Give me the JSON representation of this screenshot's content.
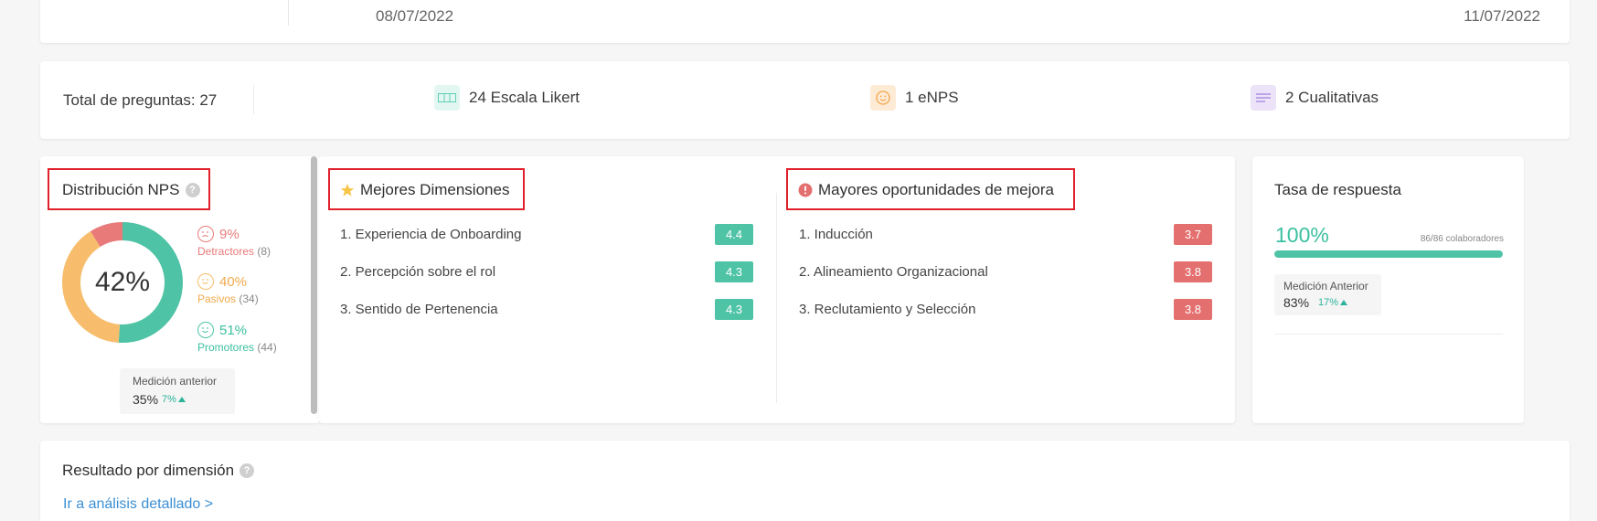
{
  "dates": {
    "start": "08/07/2022",
    "end": "11/07/2022"
  },
  "questions": {
    "total_label": "Total de preguntas: 27",
    "likert": {
      "label": "24 Escala Likert",
      "icon": "likert-scale-icon"
    },
    "enps": {
      "label": "1 eNPS",
      "icon": "smiley-icon"
    },
    "qualitative": {
      "label": "2 Cualitativas",
      "icon": "text-lines-icon"
    }
  },
  "nps": {
    "title": "Distribución NPS",
    "help": "?",
    "score": "42%",
    "segments": [
      {
        "key": "detractores",
        "pct": 9,
        "pct_label": "9%",
        "name": "Detractores",
        "count": "(8)",
        "color": "#e97a7a"
      },
      {
        "key": "pasivos",
        "pct": 40,
        "pct_label": "40%",
        "name": "Pasivos",
        "count": "(34)",
        "color": "#f7bd6c"
      },
      {
        "key": "promotores",
        "pct": 51,
        "pct_label": "51%",
        "name": "Promotores",
        "count": "(44)",
        "color": "#4ec3a6"
      }
    ],
    "previous": {
      "label": "Medición anterior",
      "value": "35%",
      "delta": "7%"
    }
  },
  "best": {
    "title": "Mejores Dimensiones",
    "items": [
      {
        "label": "1.  Experiencia de Onboarding",
        "score": "4.4"
      },
      {
        "label": "2.  Percepción sobre el rol",
        "score": "4.3"
      },
      {
        "label": "3.  Sentido de Pertenencia",
        "score": "4.3"
      }
    ]
  },
  "worst": {
    "title": "Mayores oportunidades de mejora",
    "items": [
      {
        "label": "1.  Inducción",
        "score": "3.7"
      },
      {
        "label": "2.  Alineamiento Organizacional",
        "score": "3.8"
      },
      {
        "label": "3.  Reclutamiento y Selección",
        "score": "3.8"
      }
    ]
  },
  "rate": {
    "title": "Tasa de respuesta",
    "value": "100%",
    "fraction": 1.0,
    "count": "86/86 colaboradores",
    "previous": {
      "label": "Medición Anterior",
      "value": "83%",
      "delta": "17%"
    }
  },
  "result": {
    "title": "Resultado por dimensión",
    "help": "?",
    "link": "Ir a análisis detallado >"
  },
  "colors": {
    "good": "#4ec3a6",
    "bad": "#e46f6f",
    "highlight": "#e0202a",
    "link": "#3b8fd4"
  }
}
